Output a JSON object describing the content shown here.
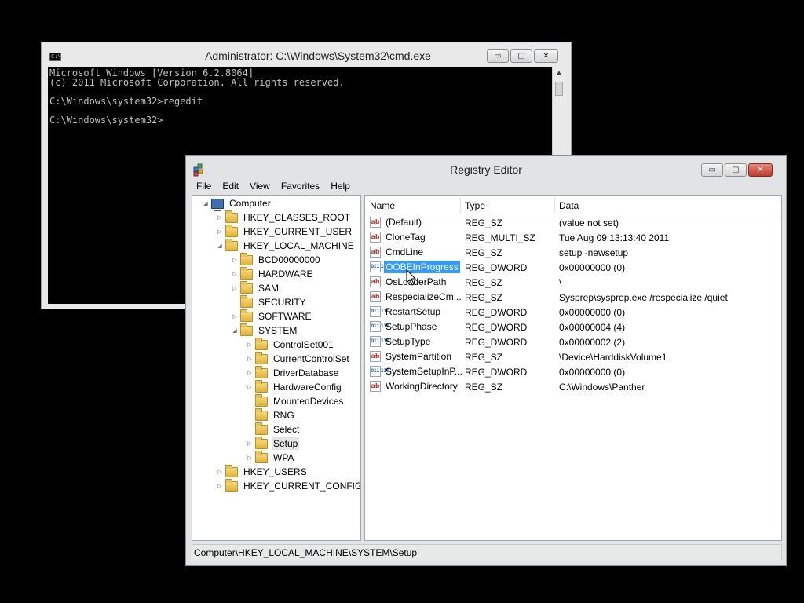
{
  "cmd": {
    "title": "Administrator: C:\\Windows\\System32\\cmd.exe",
    "icon_text": "C:\\.",
    "lines": [
      "Microsoft Windows [Version 6.2.8064]",
      "(c) 2011 Microsoft Corporation. All rights reserved.",
      "",
      "C:\\Windows\\system32>regedit",
      "",
      "C:\\Windows\\system32>"
    ]
  },
  "regedit": {
    "title": "Registry Editor",
    "menu": [
      "File",
      "Edit",
      "View",
      "Favorites",
      "Help"
    ],
    "tree": [
      {
        "label": "Computer",
        "level": 0,
        "icon": "computer-icon",
        "expander": "expanded"
      },
      {
        "label": "HKEY_CLASSES_ROOT",
        "level": 1,
        "icon": "folder-icon",
        "expander": "collapsed"
      },
      {
        "label": "HKEY_CURRENT_USER",
        "level": 1,
        "icon": "folder-icon",
        "expander": "collapsed"
      },
      {
        "label": "HKEY_LOCAL_MACHINE",
        "level": 1,
        "icon": "folder-icon",
        "expander": "expanded"
      },
      {
        "label": "BCD00000000",
        "level": 2,
        "icon": "folder-icon",
        "expander": "collapsed"
      },
      {
        "label": "HARDWARE",
        "level": 2,
        "icon": "folder-icon",
        "expander": "collapsed"
      },
      {
        "label": "SAM",
        "level": 2,
        "icon": "folder-icon",
        "expander": "collapsed"
      },
      {
        "label": "SECURITY",
        "level": 2,
        "icon": "folder-icon",
        "expander": "none"
      },
      {
        "label": "SOFTWARE",
        "level": 2,
        "icon": "folder-icon",
        "expander": "collapsed"
      },
      {
        "label": "SYSTEM",
        "level": 2,
        "icon": "folder-icon",
        "expander": "expanded"
      },
      {
        "label": "ControlSet001",
        "level": 3,
        "icon": "folder-icon",
        "expander": "collapsed"
      },
      {
        "label": "CurrentControlSet",
        "level": 3,
        "icon": "folder-icon",
        "expander": "collapsed"
      },
      {
        "label": "DriverDatabase",
        "level": 3,
        "icon": "folder-icon",
        "expander": "collapsed"
      },
      {
        "label": "HardwareConfig",
        "level": 3,
        "icon": "folder-icon",
        "expander": "collapsed"
      },
      {
        "label": "MountedDevices",
        "level": 3,
        "icon": "folder-icon",
        "expander": "none"
      },
      {
        "label": "RNG",
        "level": 3,
        "icon": "folder-icon",
        "expander": "none"
      },
      {
        "label": "Select",
        "level": 3,
        "icon": "folder-icon",
        "expander": "none"
      },
      {
        "label": "Setup",
        "level": 3,
        "icon": "folder-icon",
        "expander": "collapsed",
        "selected": true
      },
      {
        "label": "WPA",
        "level": 3,
        "icon": "folder-icon",
        "expander": "collapsed"
      },
      {
        "label": "HKEY_USERS",
        "level": 1,
        "icon": "folder-icon",
        "expander": "collapsed"
      },
      {
        "label": "HKEY_CURRENT_CONFIG",
        "level": 1,
        "icon": "folder-icon",
        "expander": "collapsed"
      }
    ],
    "columns": {
      "name": "Name",
      "type": "Type",
      "data": "Data"
    },
    "values": [
      {
        "name": "(Default)",
        "type": "REG_SZ",
        "data": "(value not set)",
        "icon": "string-value-icon"
      },
      {
        "name": "CloneTag",
        "type": "REG_MULTI_SZ",
        "data": "Tue Aug 09 13:13:40 2011",
        "icon": "string-value-icon"
      },
      {
        "name": "CmdLine",
        "type": "REG_SZ",
        "data": "setup -newsetup",
        "icon": "string-value-icon"
      },
      {
        "name": "OOBEInProgress",
        "type": "REG_DWORD",
        "data": "0x00000000 (0)",
        "icon": "dword-value-icon",
        "selected": true
      },
      {
        "name": "OsLoaderPath",
        "type": "REG_SZ",
        "data": "\\",
        "icon": "string-value-icon"
      },
      {
        "name": "RespecializeCm...",
        "type": "REG_SZ",
        "data": "Sysprep\\sysprep.exe /respecialize /quiet",
        "icon": "string-value-icon"
      },
      {
        "name": "RestartSetup",
        "type": "REG_DWORD",
        "data": "0x00000000 (0)",
        "icon": "dword-value-icon"
      },
      {
        "name": "SetupPhase",
        "type": "REG_DWORD",
        "data": "0x00000004 (4)",
        "icon": "dword-value-icon"
      },
      {
        "name": "SetupType",
        "type": "REG_DWORD",
        "data": "0x00000002 (2)",
        "icon": "dword-value-icon"
      },
      {
        "name": "SystemPartition",
        "type": "REG_SZ",
        "data": "\\Device\\HarddiskVolume1",
        "icon": "string-value-icon"
      },
      {
        "name": "SystemSetupInP...",
        "type": "REG_DWORD",
        "data": "0x00000000 (0)",
        "icon": "dword-value-icon"
      },
      {
        "name": "WorkingDirectory",
        "type": "REG_SZ",
        "data": "C:\\Windows\\Panther",
        "icon": "string-value-icon"
      }
    ],
    "status_path": "Computer\\HKEY_LOCAL_MACHINE\\SYSTEM\\Setup",
    "value_icon_text": {
      "sz": "ab",
      "dword": "011 110"
    }
  },
  "caption": {
    "minimize": "▭",
    "maximize": "▢",
    "close": "✕"
  },
  "colors": {
    "selection": "#3399ff",
    "close_button": "#c0392b",
    "console_bg": "#000000",
    "console_text": "#c0c0c0"
  }
}
